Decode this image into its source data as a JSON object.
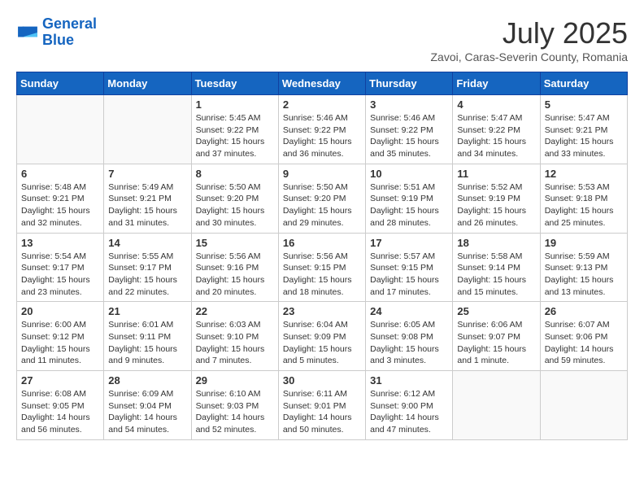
{
  "logo": {
    "line1": "General",
    "line2": "Blue"
  },
  "title": "July 2025",
  "subtitle": "Zavoi, Caras-Severin County, Romania",
  "weekdays": [
    "Sunday",
    "Monday",
    "Tuesday",
    "Wednesday",
    "Thursday",
    "Friday",
    "Saturday"
  ],
  "weeks": [
    [
      {
        "day": "",
        "info": ""
      },
      {
        "day": "",
        "info": ""
      },
      {
        "day": "1",
        "info": "Sunrise: 5:45 AM\nSunset: 9:22 PM\nDaylight: 15 hours and 37 minutes."
      },
      {
        "day": "2",
        "info": "Sunrise: 5:46 AM\nSunset: 9:22 PM\nDaylight: 15 hours and 36 minutes."
      },
      {
        "day": "3",
        "info": "Sunrise: 5:46 AM\nSunset: 9:22 PM\nDaylight: 15 hours and 35 minutes."
      },
      {
        "day": "4",
        "info": "Sunrise: 5:47 AM\nSunset: 9:22 PM\nDaylight: 15 hours and 34 minutes."
      },
      {
        "day": "5",
        "info": "Sunrise: 5:47 AM\nSunset: 9:21 PM\nDaylight: 15 hours and 33 minutes."
      }
    ],
    [
      {
        "day": "6",
        "info": "Sunrise: 5:48 AM\nSunset: 9:21 PM\nDaylight: 15 hours and 32 minutes."
      },
      {
        "day": "7",
        "info": "Sunrise: 5:49 AM\nSunset: 9:21 PM\nDaylight: 15 hours and 31 minutes."
      },
      {
        "day": "8",
        "info": "Sunrise: 5:50 AM\nSunset: 9:20 PM\nDaylight: 15 hours and 30 minutes."
      },
      {
        "day": "9",
        "info": "Sunrise: 5:50 AM\nSunset: 9:20 PM\nDaylight: 15 hours and 29 minutes."
      },
      {
        "day": "10",
        "info": "Sunrise: 5:51 AM\nSunset: 9:19 PM\nDaylight: 15 hours and 28 minutes."
      },
      {
        "day": "11",
        "info": "Sunrise: 5:52 AM\nSunset: 9:19 PM\nDaylight: 15 hours and 26 minutes."
      },
      {
        "day": "12",
        "info": "Sunrise: 5:53 AM\nSunset: 9:18 PM\nDaylight: 15 hours and 25 minutes."
      }
    ],
    [
      {
        "day": "13",
        "info": "Sunrise: 5:54 AM\nSunset: 9:17 PM\nDaylight: 15 hours and 23 minutes."
      },
      {
        "day": "14",
        "info": "Sunrise: 5:55 AM\nSunset: 9:17 PM\nDaylight: 15 hours and 22 minutes."
      },
      {
        "day": "15",
        "info": "Sunrise: 5:56 AM\nSunset: 9:16 PM\nDaylight: 15 hours and 20 minutes."
      },
      {
        "day": "16",
        "info": "Sunrise: 5:56 AM\nSunset: 9:15 PM\nDaylight: 15 hours and 18 minutes."
      },
      {
        "day": "17",
        "info": "Sunrise: 5:57 AM\nSunset: 9:15 PM\nDaylight: 15 hours and 17 minutes."
      },
      {
        "day": "18",
        "info": "Sunrise: 5:58 AM\nSunset: 9:14 PM\nDaylight: 15 hours and 15 minutes."
      },
      {
        "day": "19",
        "info": "Sunrise: 5:59 AM\nSunset: 9:13 PM\nDaylight: 15 hours and 13 minutes."
      }
    ],
    [
      {
        "day": "20",
        "info": "Sunrise: 6:00 AM\nSunset: 9:12 PM\nDaylight: 15 hours and 11 minutes."
      },
      {
        "day": "21",
        "info": "Sunrise: 6:01 AM\nSunset: 9:11 PM\nDaylight: 15 hours and 9 minutes."
      },
      {
        "day": "22",
        "info": "Sunrise: 6:03 AM\nSunset: 9:10 PM\nDaylight: 15 hours and 7 minutes."
      },
      {
        "day": "23",
        "info": "Sunrise: 6:04 AM\nSunset: 9:09 PM\nDaylight: 15 hours and 5 minutes."
      },
      {
        "day": "24",
        "info": "Sunrise: 6:05 AM\nSunset: 9:08 PM\nDaylight: 15 hours and 3 minutes."
      },
      {
        "day": "25",
        "info": "Sunrise: 6:06 AM\nSunset: 9:07 PM\nDaylight: 15 hours and 1 minute."
      },
      {
        "day": "26",
        "info": "Sunrise: 6:07 AM\nSunset: 9:06 PM\nDaylight: 14 hours and 59 minutes."
      }
    ],
    [
      {
        "day": "27",
        "info": "Sunrise: 6:08 AM\nSunset: 9:05 PM\nDaylight: 14 hours and 56 minutes."
      },
      {
        "day": "28",
        "info": "Sunrise: 6:09 AM\nSunset: 9:04 PM\nDaylight: 14 hours and 54 minutes."
      },
      {
        "day": "29",
        "info": "Sunrise: 6:10 AM\nSunset: 9:03 PM\nDaylight: 14 hours and 52 minutes."
      },
      {
        "day": "30",
        "info": "Sunrise: 6:11 AM\nSunset: 9:01 PM\nDaylight: 14 hours and 50 minutes."
      },
      {
        "day": "31",
        "info": "Sunrise: 6:12 AM\nSunset: 9:00 PM\nDaylight: 14 hours and 47 minutes."
      },
      {
        "day": "",
        "info": ""
      },
      {
        "day": "",
        "info": ""
      }
    ]
  ]
}
